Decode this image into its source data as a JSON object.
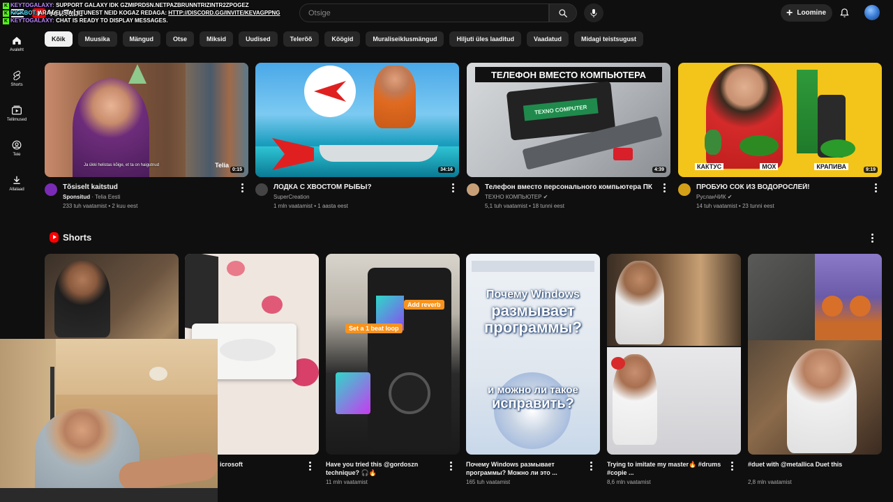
{
  "header": {
    "logo_text": "YouTube",
    "search_placeholder": "Otsige",
    "create_label": "Loomine"
  },
  "chat": [
    {
      "user": "KEYTOGALAXY:",
      "text": "SUPPORT GALAXY IDK GZMIPRDSN.NETPAZBRUNNTRIZINTR2ZPOGEZ"
    },
    {
      "user": "KICKBOT:",
      "text": "ARA LEUSIA LIITUNEST NEID KOGAZ REDAGA:",
      "link": "HTTP://DISCORD.GG/INVITE/KEVAGPPNG"
    },
    {
      "user": "KEYTOGALAXY:",
      "text": "CHAT IS READY TO DISPLAY MESSAGES."
    }
  ],
  "sidebar": [
    {
      "label": "Avaleht",
      "icon": "home-icon"
    },
    {
      "label": "Shorts",
      "icon": "shorts-icon"
    },
    {
      "label": "Tellimused",
      "icon": "subscriptions-icon"
    },
    {
      "label": "Teie",
      "icon": "you-icon"
    },
    {
      "label": "Allalaad",
      "icon": "download-icon"
    }
  ],
  "chips": [
    "Kõik",
    "Muusika",
    "Mängud",
    "Otse",
    "Miksid",
    "Uudised",
    "Telerõõ",
    "Köögid",
    "Muraliseiklusmängud",
    "Hiljuti üles laaditud",
    "Vaadatud",
    "Midagi teistsugust"
  ],
  "videos": [
    {
      "title": "Tõsiselt kaitstud",
      "channel": "Sponsitud",
      "channel_suffix": "· Telia Eesti",
      "stats": "233 tuh vaatamist • 2 kuu eest",
      "duration": "0:15",
      "avatar_color": "#7a2bb5",
      "subtitle": "Ja ükki helistas kõige, et ta on haigutnud",
      "brand": "Telia"
    },
    {
      "title": "ЛОДКА С ХВОСТОМ РЫБЫ?",
      "channel": "SuperCreation",
      "channel_suffix": "",
      "stats": "1 mln vaatamist • 1 aasta eest",
      "duration": "34:16",
      "avatar_color": "#444444"
    },
    {
      "title": "Телефон вместо персонального компьютера ПК",
      "channel": "ТЕХНО КОМПЬЮТЕР",
      "channel_suffix": "",
      "stats": "5,1 tuh vaatamist • 18 tunni eest",
      "duration": "4:39",
      "avatar_color": "#c8a078",
      "banner": "ТЕЛЕФОН ВМЕСТО КОМПЬЮТЕРА",
      "screen_text": "TEXNO COMPUTER"
    },
    {
      "title": "ПРОБУЮ СОК ИЗ ВОДОРОСЛЕЙ!",
      "channel": "РусланЧИК",
      "channel_suffix": "",
      "stats": "14 tuh vaatamist • 23 tunni eest",
      "duration": "9:19",
      "avatar_color": "#d4a017",
      "labels": [
        "КАКТУС",
        "МОХ",
        "КРАПИВА"
      ]
    }
  ],
  "shorts": {
    "heading": "Shorts",
    "items": [
      {
        "title": "",
        "views": ""
      },
      {
        "title": "icrosoft",
        "views": ""
      },
      {
        "title": "Have you tried this @gordoszn technique? 🎧🔥",
        "views": "11 mln vaatamist",
        "tag1": "Add reverb",
        "tag2": "Set a 1 beat loop"
      },
      {
        "title": "Почему Windows размывает программы? Можно ли это ...",
        "views": "165 tuh vaatamist",
        "overlay_top": "Почему Windows",
        "overlay_mid1": "размывает",
        "overlay_mid2": "программы?",
        "overlay_bot1": "и можно ли такое",
        "overlay_bot2": "исправить?"
      },
      {
        "title": "Trying to imitate my master🔥 #drums #copie ...",
        "views": "8,6 mln vaatamist"
      },
      {
        "title": "#duet with @metallica Duet this",
        "views": "2,8 mln vaatamist"
      }
    ]
  },
  "colors": {
    "background": "#0f0f0f",
    "chip": "#272727",
    "accent_red": "#ff0000",
    "kick_green": "#53fc18"
  }
}
